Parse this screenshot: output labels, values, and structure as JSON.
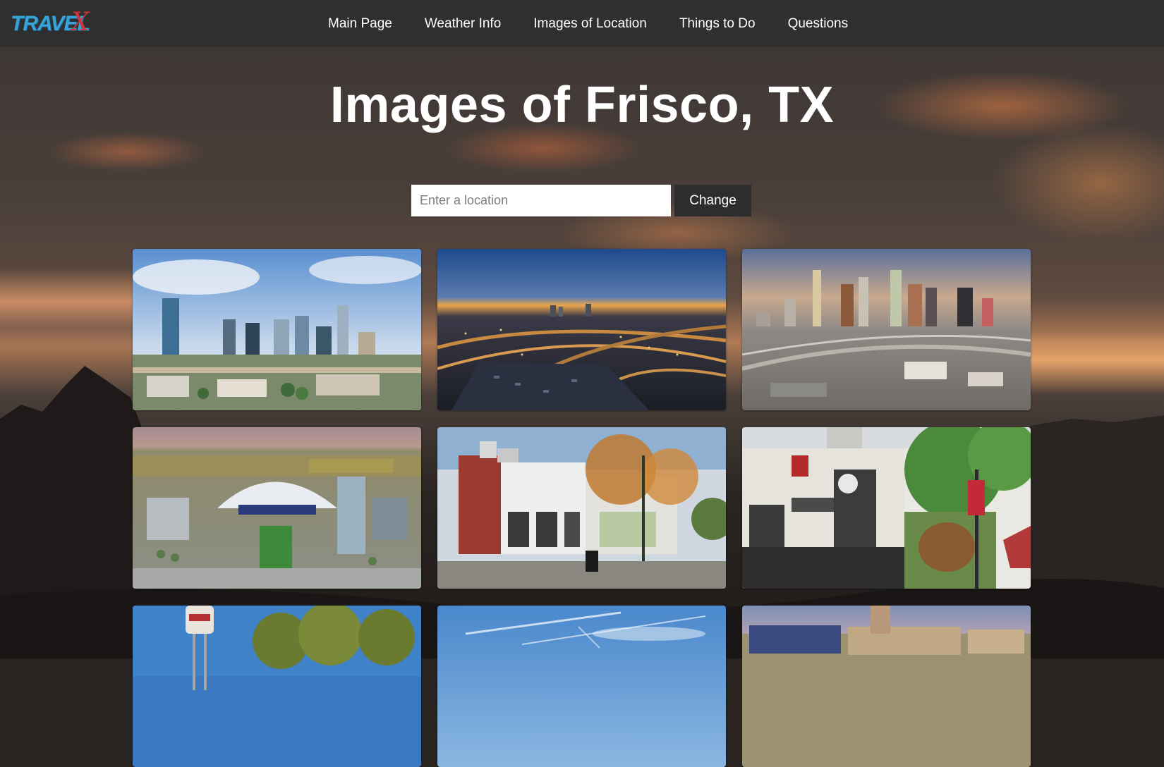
{
  "nav": {
    "logo": {
      "text": "TRAVEL",
      "mark": "X"
    },
    "links": [
      {
        "label": "Main Page"
      },
      {
        "label": "Weather Info"
      },
      {
        "label": "Images of Location"
      },
      {
        "label": "Things to Do"
      },
      {
        "label": "Questions"
      }
    ]
  },
  "page": {
    "title": "Images of Frisco, TX"
  },
  "search": {
    "placeholder": "Enter a location",
    "value": "",
    "button_label": "Change"
  },
  "gallery": {
    "images": [
      {
        "subject": "dallas-skyline-daytime"
      },
      {
        "subject": "highway-interchange-dusk"
      },
      {
        "subject": "aerial-city-skyline"
      },
      {
        "subject": "stadium-aerial"
      },
      {
        "subject": "downtown-storefronts-autumn"
      },
      {
        "subject": "downtown-storefront-mural"
      },
      {
        "subject": "water-tower-trees"
      },
      {
        "subject": "sky-with-contrails"
      },
      {
        "subject": "campus-building"
      }
    ]
  },
  "colors": {
    "nav_bg": "#2f2f2f",
    "button_bg": "#2d2d2d",
    "logo_blue": "#3aa3d8",
    "logo_red": "#d4333a"
  }
}
